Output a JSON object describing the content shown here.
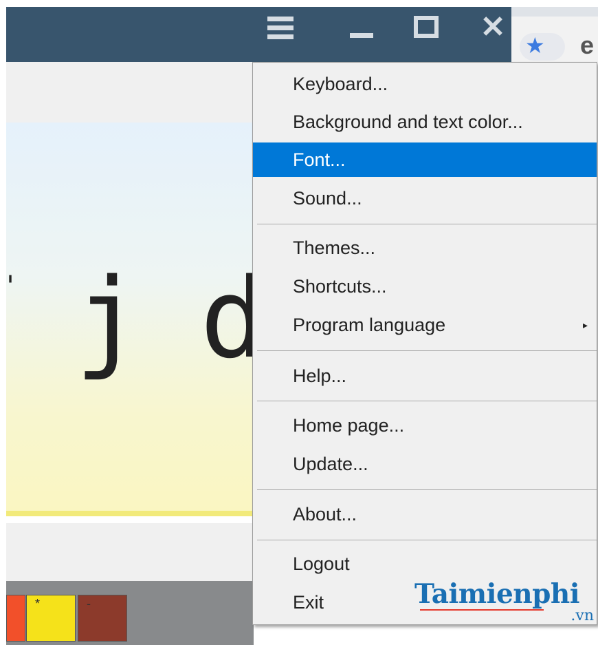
{
  "titlebar": {
    "icons": [
      "hamburger-menu-icon",
      "minimize-icon",
      "maximize-icon",
      "close-icon"
    ],
    "background": "#38556d"
  },
  "browser": {
    "icons": [
      "bookmark-star-icon",
      "browser-e-icon"
    ]
  },
  "typing_area": {
    "characters": [
      "'",
      "j",
      "d"
    ]
  },
  "keys": [
    {
      "color": "#f2502a",
      "label": ""
    },
    {
      "color": "#f5e21a",
      "label": "*"
    },
    {
      "color": "#8c3a2b",
      "label": "-"
    }
  ],
  "menu": {
    "items": [
      {
        "label": "Keyboard..."
      },
      {
        "label": "Background and text color..."
      },
      {
        "label": "Font...",
        "highlighted": true
      },
      {
        "label": "Sound..."
      },
      {
        "label": "Themes..."
      },
      {
        "label": "Shortcuts..."
      },
      {
        "label": "Program language",
        "has_submenu": true
      },
      {
        "label": "Help..."
      },
      {
        "label": "Home page..."
      },
      {
        "label": "Update..."
      },
      {
        "label": "About..."
      },
      {
        "label": "Logout"
      },
      {
        "label": "Exit"
      }
    ],
    "highlight_color": "#0078d7"
  },
  "watermark": {
    "brand": "Taimienphi",
    "suffix": ".vn"
  }
}
